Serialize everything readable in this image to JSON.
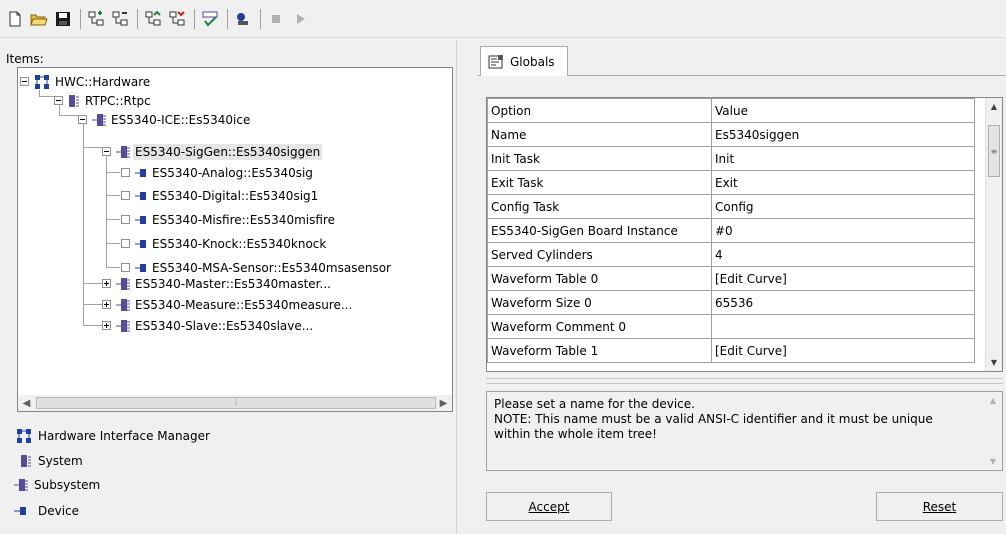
{
  "toolbar": {
    "buttons": [
      "new-icon",
      "open-icon",
      "save-icon",
      "add-item-icon",
      "remove-item-icon",
      "expand-tree-icon",
      "collapse-tree-icon",
      "check-icon",
      "run-icon",
      "stop-icon",
      "play-icon"
    ]
  },
  "left": {
    "items_label": "Items:",
    "tree": [
      {
        "label": "HWC::Hardware"
      },
      {
        "label": "RTPC::Rtpc"
      },
      {
        "label": "ES5340-ICE::Es5340ice"
      },
      {
        "label": "ES5340-SigGen::Es5340siggen"
      },
      {
        "label": "ES5340-Analog::Es5340sig"
      },
      {
        "label": "ES5340-Digital::Es5340sig1"
      },
      {
        "label": "ES5340-Misfire::Es5340misfire"
      },
      {
        "label": "ES5340-Knock::Es5340knock"
      },
      {
        "label": "ES5340-MSA-Sensor::Es5340msasensor"
      },
      {
        "label": "ES5340-Master::Es5340master..."
      },
      {
        "label": "ES5340-Measure::Es5340measure..."
      },
      {
        "label": "ES5340-Slave::Es5340slave..."
      }
    ],
    "legend": [
      {
        "label": "Hardware Interface Manager"
      },
      {
        "label": "System"
      },
      {
        "label": "Subsystem"
      },
      {
        "label": "Device"
      }
    ]
  },
  "right": {
    "tab_label": "Globals",
    "grid": {
      "headers": [
        "Option",
        "Value"
      ],
      "rows": [
        [
          "Name",
          "Es5340siggen"
        ],
        [
          "Init Task",
          "Init"
        ],
        [
          "Exit Task",
          "Exit"
        ],
        [
          "Config Task",
          "Config"
        ],
        [
          "ES5340-SigGen Board Instance",
          "#0"
        ],
        [
          "Served Cylinders",
          "4"
        ],
        [
          "Waveform Table 0",
          "[Edit Curve]"
        ],
        [
          "Waveform Size 0",
          "65536"
        ],
        [
          "Waveform Comment 0",
          ""
        ],
        [
          "Waveform Table 1",
          "[Edit Curve]"
        ]
      ]
    },
    "description": {
      "line1": "Please set a name for the device.",
      "line2": "NOTE: This name must be a valid ANSI-C identifier and it must be unique",
      "line3": "within the whole item tree!"
    },
    "accept_label": "Accept",
    "reset_label": "Reset"
  },
  "colors": {
    "device_blue": "#2040a0",
    "system_purple": "#5a4a9a",
    "green": "#208040",
    "red": "#c02020"
  }
}
